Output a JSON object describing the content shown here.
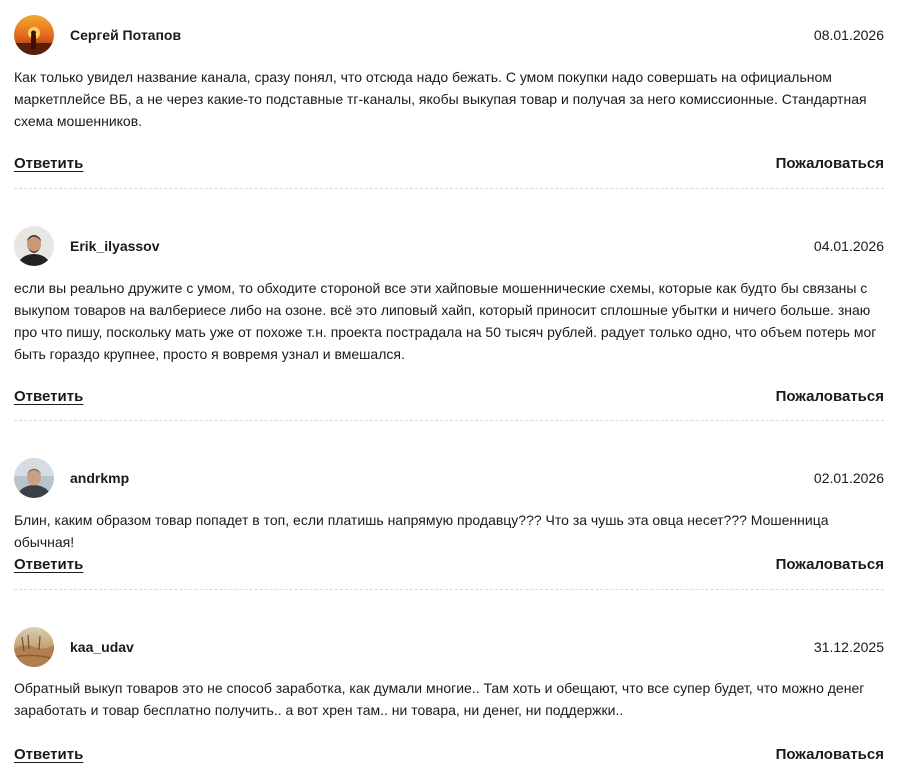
{
  "comments": [
    {
      "username": "Сергей Потапов",
      "date": "08.01.2026",
      "avatar_icon": "avatar-sunset-person",
      "text": "Как только увидел название канала, сразу понял, что отсюда надо бежать. С умом покупки надо совершать на официальном маркетплейсе ВБ, а не через какие-то подставные тг-каналы, якобы выкупая товар и получая за него комиссионные. Стандартная схема мошенников.",
      "reply_label": "Ответить",
      "report_label": "Пожаловаться"
    },
    {
      "username": "Erik_ilyassov",
      "date": "04.01.2026",
      "avatar_icon": "avatar-man-portrait",
      "text": "если вы реально дружите с умом, то обходите стороной все эти хайповые мошеннические схемы, которые как будто бы связаны с выкупом товаров на валбериесе либо на озоне. всё это липовый хайп, который приносит сплошные убытки и ничего больше. знаю про что пишу, поскольку мать уже от похоже т.н. проекта пострадала на 50 тысяч рублей. радует только одно, что объем потерь мог быть гораздо крупнее, просто я вовремя узнал и вмешался.",
      "reply_label": "Ответить",
      "report_label": "Пожаловаться"
    },
    {
      "username": "andrkmp",
      "date": "02.01.2026",
      "avatar_icon": "avatar-man-outdoor",
      "text": "Блин, каким образом товар попадет в топ, если платишь напрямую продавцу??? Что за чушь эта овца несет??? Мошенница обычная!",
      "reply_label": "Ответить",
      "report_label": "Пожаловаться"
    },
    {
      "username": "kaa_udav",
      "date": "31.12.2025",
      "avatar_icon": "avatar-desert-landscape",
      "text": "Обратный выкуп товаров это не способ заработка, как думали многие.. Там хоть и обещают, что все супер будет, что можно денег заработать и товар бесплатно получить.. а вот хрен там.. ни товара, ни денег, ни поддержки..",
      "reply_label": "Ответить",
      "report_label": "Пожаловаться"
    }
  ]
}
